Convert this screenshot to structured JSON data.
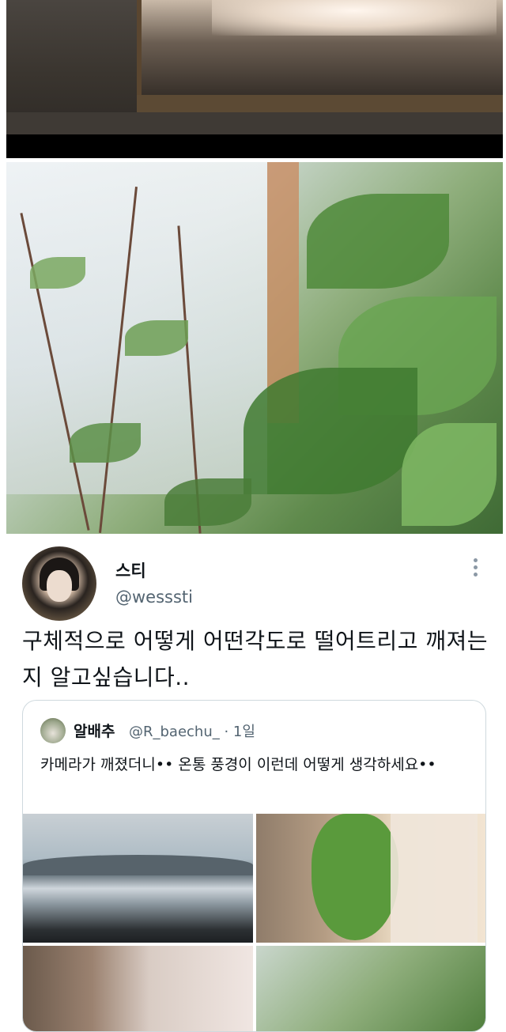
{
  "tweet": {
    "display_name": "스티",
    "handle": "@wesssti",
    "text": "구체적으로 어떻게 어떤각도로 떨어트리고 깨져는지 알고싶습니다.."
  },
  "quoted_tweet": {
    "display_name": "알배추",
    "handle_time": "@R_baechu_ · 1일",
    "text": "카메라가 깨졌더니•• 온통 풍경이 이런데 어떻게 생각하세요••"
  },
  "icons": {
    "more": "more-vertical-icon"
  }
}
